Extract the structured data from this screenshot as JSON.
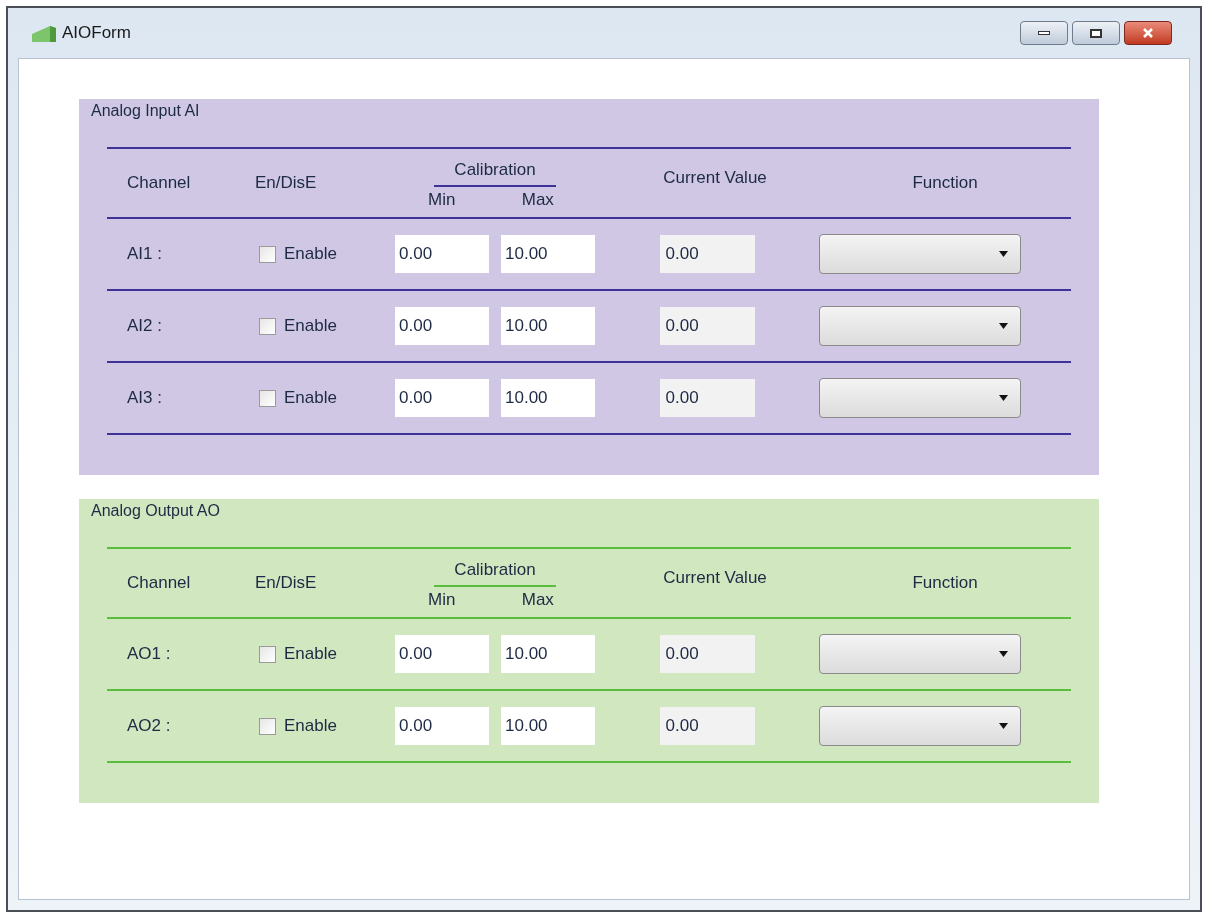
{
  "window": {
    "title": "AIOForm"
  },
  "sections": [
    {
      "kind": "input",
      "title": "Analog Input AI",
      "headers": {
        "channel": "Channel",
        "enable": "En/DisE",
        "calibration": "Calibration",
        "min": "Min",
        "max": "Max",
        "current": "Current Value",
        "function": "Function"
      },
      "rows": [
        {
          "channel": "AI1 :",
          "checked": false,
          "enable_label": "Enable",
          "min": "0.00",
          "max": "10.00",
          "current": "0.00"
        },
        {
          "channel": "AI2 :",
          "checked": false,
          "enable_label": "Enable",
          "min": "0.00",
          "max": "10.00",
          "current": "0.00"
        },
        {
          "channel": "AI3 :",
          "checked": false,
          "enable_label": "Enable",
          "min": "0.00",
          "max": "10.00",
          "current": "0.00"
        }
      ]
    },
    {
      "kind": "output",
      "title": "Analog Output AO",
      "headers": {
        "channel": "Channel",
        "enable": "En/DisE",
        "calibration": "Calibration",
        "min": "Min",
        "max": "Max",
        "current": "Current Value",
        "function": "Function"
      },
      "rows": [
        {
          "channel": "AO1 :",
          "checked": false,
          "enable_label": "Enable",
          "min": "0.00",
          "max": "10.00",
          "current": "0.00"
        },
        {
          "channel": "AO2 :",
          "checked": false,
          "enable_label": "Enable",
          "min": "0.00",
          "max": "10.00",
          "current": "0.00"
        }
      ]
    }
  ]
}
